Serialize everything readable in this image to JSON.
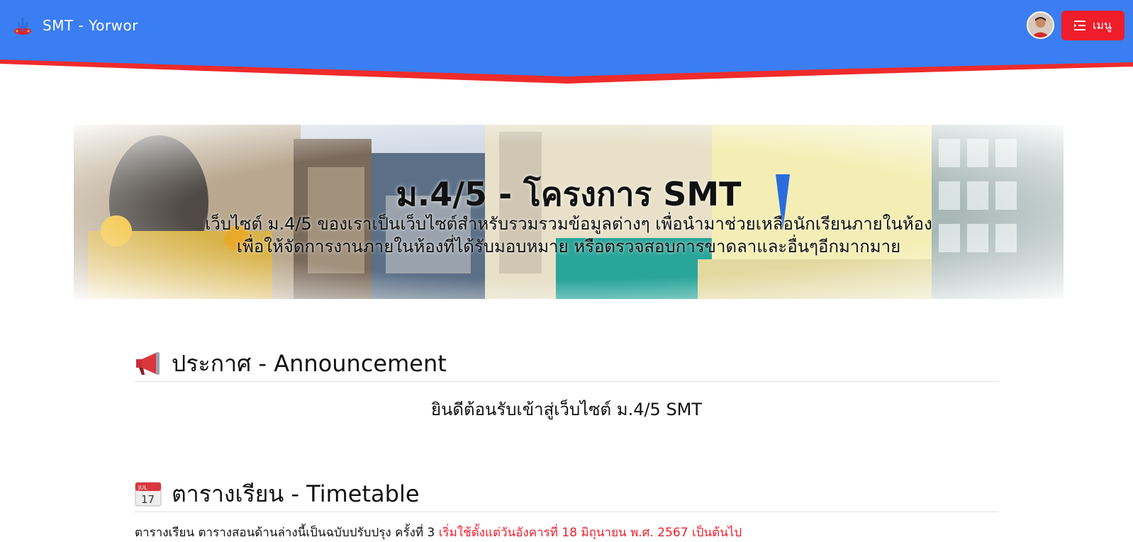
{
  "navbar": {
    "brand": "SMT - Yorwor",
    "menu_label": "เมนู",
    "color": "#3b7df2",
    "accent": "#ef1d2a",
    "icons": [
      "trident-logo-icon",
      "user-avatar",
      "menu-list-icon"
    ]
  },
  "hero": {
    "title": "ม.4/5 - โครงการ SMT",
    "subtitle_line1": "เว็บไซต์ ม.4/5 ของเราเป็นเว็บไซต์สำหรับรวมรวมข้อมูลต่างๆ เพื่อนำมาช่วยเหลือนักเรียนภายในห้อง",
    "subtitle_line2": "เพื่อให้จัดการงานภายในห้องที่ได้รับมอบหมาย หรือตรวจสอบการขาดลาและอื่นๆอีกมากมาย"
  },
  "announcement": {
    "heading": "ประกาศ - Announcement",
    "icon": "megaphone-icon",
    "text": "ยินดีต้อนรับเข้าสู่เว็บไซต์ ม.4/5 SMT"
  },
  "timetable": {
    "heading": "ตารางเรียน - Timetable",
    "icon": "calendar-icon",
    "calendar_month": "JUL",
    "calendar_day": "17",
    "note_text": "ตารางเรียน ตารางสอนด้านล่างนี้เป็นฉบับปรับปรุง ครั้งที่ 3 ",
    "note_highlight": "เริ่มใช้ตั้งแต่วันอังคารที่ 18 มิถุนายน พ.ศ. 2567 เป็นต้นไป"
  }
}
